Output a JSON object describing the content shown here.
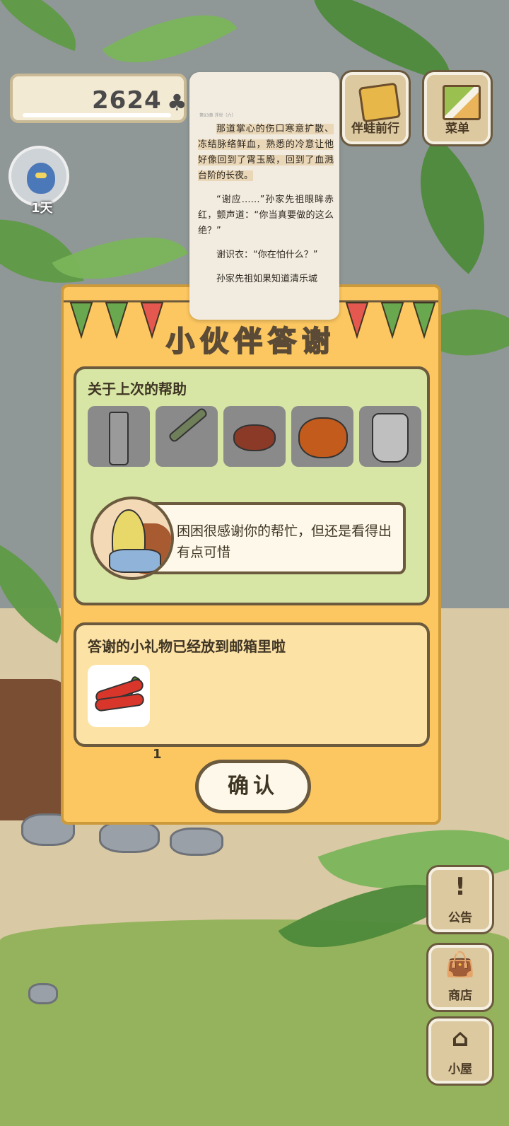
{
  "hud": {
    "score": "2624",
    "clover_icon": "♣",
    "day_label": "1天",
    "travel_button_label": "伴蛙前行",
    "menu_button_label": "菜单"
  },
  "side_buttons": [
    {
      "glyph": "!",
      "label": "公告"
    },
    {
      "glyph": "",
      "label": "商店"
    },
    {
      "glyph": "",
      "label": "小屋"
    }
  ],
  "reader": {
    "chapter_line": "第93章 浮世（六）",
    "paragraphs": [
      "那道掌心的伤口寒意扩散、冻结脉络鲜血，熟悉的冷意让他好像回到了霄玉殿，回到了血溅台阶的长夜。",
      "“谢应……”孙家先祖眼眸赤红，颤声道：“你当真要做的这么绝？”",
      "谢识衣：“你在怕什么？”",
      "孙家先祖如果知道清乐城"
    ]
  },
  "dialog": {
    "title": "小伙伴答谢",
    "help_section_title": "关于上次的帮助",
    "items": [
      "bottle",
      "scallion",
      "chestnut",
      "persimmon",
      "pitcher"
    ],
    "speech_text": "困困很感谢你的帮忙，但还是看得出有点可惜",
    "gift_section_title": "答谢的小礼物已经放到邮箱里啦",
    "gift": {
      "name": "chili",
      "quantity": "1"
    },
    "confirm_label": "确认"
  },
  "colors": {
    "dialog_bg": "#fcc760",
    "help_bg": "#d7e6a4",
    "gift_bg": "#fde2a6",
    "outline": "#6b5a3e"
  }
}
